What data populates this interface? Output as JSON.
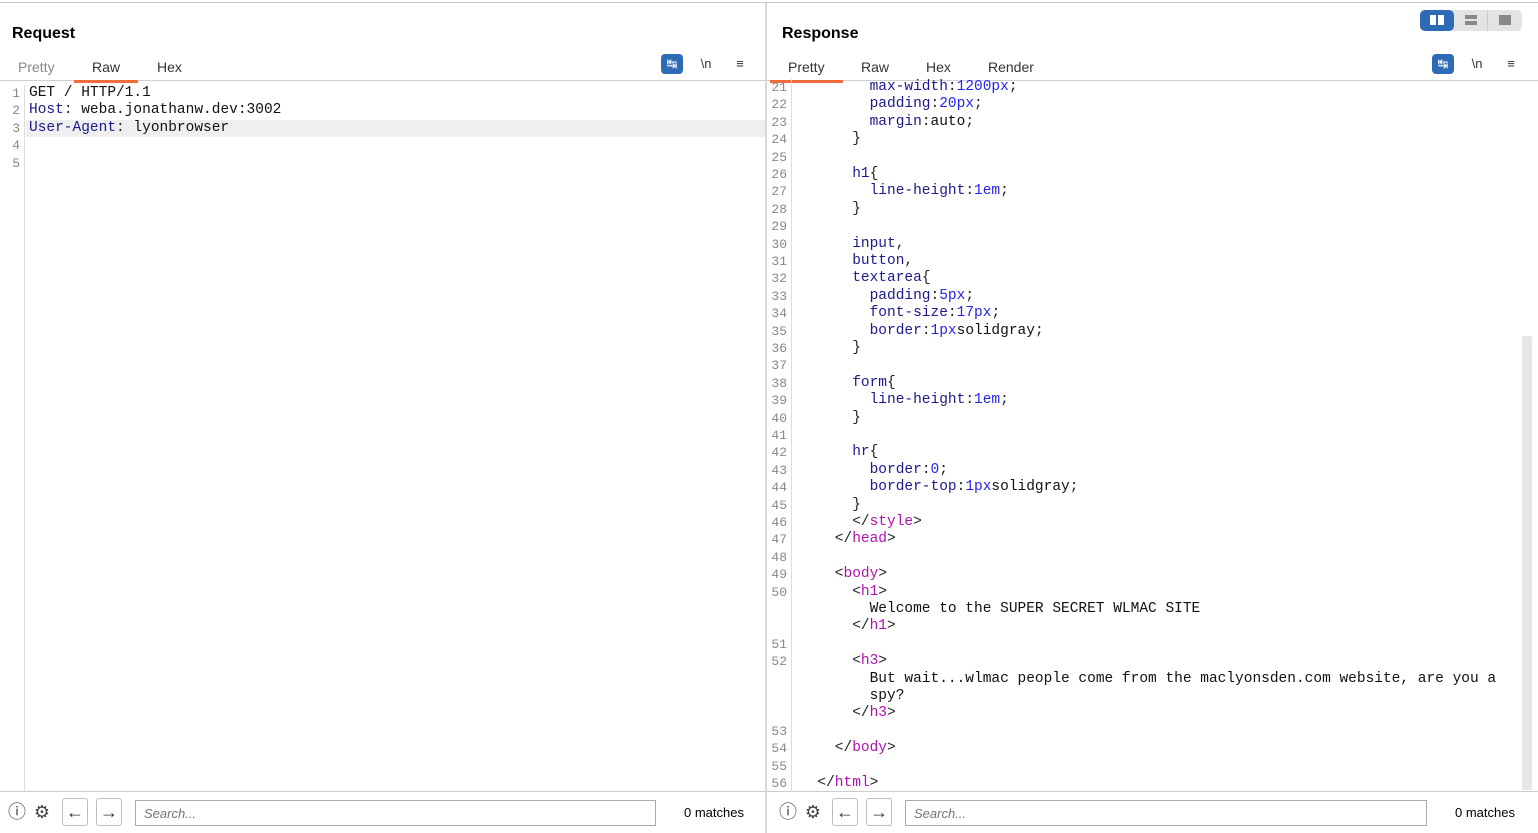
{
  "request": {
    "title": "Request",
    "tabs": [
      "Pretty",
      "Raw",
      "Hex"
    ],
    "active_tab": "Raw",
    "lines": [
      {
        "n": "1",
        "indent": 0,
        "tokens": [
          [
            "txt",
            "GET / HTTP/1.1"
          ]
        ]
      },
      {
        "n": "2",
        "indent": 0,
        "tokens": [
          [
            "prop",
            "Host"
          ],
          [
            "p",
            ": "
          ],
          [
            "txt",
            "weba.jonathanw.dev:3002"
          ]
        ]
      },
      {
        "n": "3",
        "indent": 0,
        "highlight": true,
        "tokens": [
          [
            "prop",
            "User-Agent"
          ],
          [
            "p",
            ": "
          ],
          [
            "txt",
            "lyonbrowser"
          ]
        ]
      },
      {
        "n": "4",
        "indent": 0,
        "tokens": []
      },
      {
        "n": "5",
        "indent": 0,
        "tokens": []
      }
    ],
    "search_placeholder": "Search...",
    "matches": "0 matches"
  },
  "response": {
    "title": "Response",
    "tabs": [
      "Pretty",
      "Raw",
      "Hex",
      "Render"
    ],
    "active_tab": "Pretty",
    "lines": [
      {
        "n": "21",
        "indent": 8,
        "tokens": [
          [
            "prop",
            "max-width"
          ],
          [
            "p",
            ":"
          ],
          [
            "val",
            "1200px"
          ],
          [
            "p",
            ";"
          ]
        ]
      },
      {
        "n": "22",
        "indent": 8,
        "tokens": [
          [
            "prop",
            "padding"
          ],
          [
            "p",
            ":"
          ],
          [
            "val",
            "20px"
          ],
          [
            "p",
            ";"
          ]
        ]
      },
      {
        "n": "23",
        "indent": 8,
        "tokens": [
          [
            "prop",
            "margin"
          ],
          [
            "p",
            ":"
          ],
          [
            "txt",
            "auto"
          ],
          [
            "p",
            ";"
          ]
        ]
      },
      {
        "n": "24",
        "indent": 6,
        "tokens": [
          [
            "p",
            "}"
          ]
        ]
      },
      {
        "n": "25",
        "indent": 0,
        "tokens": []
      },
      {
        "n": "26",
        "indent": 6,
        "tokens": [
          [
            "prop",
            "h1"
          ],
          [
            "p",
            "{"
          ]
        ]
      },
      {
        "n": "27",
        "indent": 8,
        "tokens": [
          [
            "prop",
            "line-height"
          ],
          [
            "p",
            ":"
          ],
          [
            "val",
            "1em"
          ],
          [
            "p",
            ";"
          ]
        ]
      },
      {
        "n": "28",
        "indent": 6,
        "tokens": [
          [
            "p",
            "}"
          ]
        ]
      },
      {
        "n": "29",
        "indent": 0,
        "tokens": []
      },
      {
        "n": "30",
        "indent": 6,
        "tokens": [
          [
            "prop",
            "input"
          ],
          [
            "p",
            ","
          ]
        ]
      },
      {
        "n": "31",
        "indent": 6,
        "tokens": [
          [
            "prop",
            "button"
          ],
          [
            "p",
            ","
          ]
        ]
      },
      {
        "n": "32",
        "indent": 6,
        "tokens": [
          [
            "prop",
            "textarea"
          ],
          [
            "p",
            "{"
          ]
        ]
      },
      {
        "n": "33",
        "indent": 8,
        "tokens": [
          [
            "prop",
            "padding"
          ],
          [
            "p",
            ":"
          ],
          [
            "val",
            "5px"
          ],
          [
            "p",
            ";"
          ]
        ]
      },
      {
        "n": "34",
        "indent": 8,
        "tokens": [
          [
            "prop",
            "font-size"
          ],
          [
            "p",
            ":"
          ],
          [
            "val",
            "17px"
          ],
          [
            "p",
            ";"
          ]
        ]
      },
      {
        "n": "35",
        "indent": 8,
        "tokens": [
          [
            "prop",
            "border"
          ],
          [
            "p",
            ":"
          ],
          [
            "val",
            "1px"
          ],
          [
            "txt",
            "solidgray"
          ],
          [
            "p",
            ";"
          ]
        ]
      },
      {
        "n": "36",
        "indent": 6,
        "tokens": [
          [
            "p",
            "}"
          ]
        ]
      },
      {
        "n": "37",
        "indent": 0,
        "tokens": []
      },
      {
        "n": "38",
        "indent": 6,
        "tokens": [
          [
            "prop",
            "form"
          ],
          [
            "p",
            "{"
          ]
        ]
      },
      {
        "n": "39",
        "indent": 8,
        "tokens": [
          [
            "prop",
            "line-height"
          ],
          [
            "p",
            ":"
          ],
          [
            "val",
            "1em"
          ],
          [
            "p",
            ";"
          ]
        ]
      },
      {
        "n": "40",
        "indent": 6,
        "tokens": [
          [
            "p",
            "}"
          ]
        ]
      },
      {
        "n": "41",
        "indent": 0,
        "tokens": []
      },
      {
        "n": "42",
        "indent": 6,
        "tokens": [
          [
            "prop",
            "hr"
          ],
          [
            "p",
            "{"
          ]
        ]
      },
      {
        "n": "43",
        "indent": 8,
        "tokens": [
          [
            "prop",
            "border"
          ],
          [
            "p",
            ":"
          ],
          [
            "val",
            "0"
          ],
          [
            "p",
            ";"
          ]
        ]
      },
      {
        "n": "44",
        "indent": 8,
        "tokens": [
          [
            "prop",
            "border-top"
          ],
          [
            "p",
            ":"
          ],
          [
            "val",
            "1px"
          ],
          [
            "txt",
            "solidgray"
          ],
          [
            "p",
            ";"
          ]
        ]
      },
      {
        "n": "45",
        "indent": 6,
        "tokens": [
          [
            "p",
            "}"
          ]
        ]
      },
      {
        "n": "46",
        "indent": 6,
        "tokens": [
          [
            "p",
            "</"
          ],
          [
            "tag",
            "style"
          ],
          [
            "p",
            ">"
          ]
        ]
      },
      {
        "n": "47",
        "indent": 4,
        "tokens": [
          [
            "p",
            "</"
          ],
          [
            "tag",
            "head"
          ],
          [
            "p",
            ">"
          ]
        ]
      },
      {
        "n": "48",
        "indent": 0,
        "tokens": []
      },
      {
        "n": "49",
        "indent": 4,
        "tokens": [
          [
            "p",
            "<"
          ],
          [
            "tag",
            "body"
          ],
          [
            "p",
            ">"
          ]
        ]
      },
      {
        "n": "50",
        "indent": 6,
        "tokens": [
          [
            "p",
            "<"
          ],
          [
            "tag",
            "h1"
          ],
          [
            "p",
            ">"
          ]
        ]
      },
      {
        "n": "",
        "indent": 8,
        "tokens": [
          [
            "txt",
            "Welcome to the SUPER SECRET WLMAC SITE"
          ]
        ]
      },
      {
        "n": "",
        "indent": 6,
        "tokens": [
          [
            "p",
            "</"
          ],
          [
            "tag",
            "h1"
          ],
          [
            "p",
            ">"
          ]
        ]
      },
      {
        "n": "51",
        "indent": 0,
        "tokens": []
      },
      {
        "n": "52",
        "indent": 6,
        "tokens": [
          [
            "p",
            "<"
          ],
          [
            "tag",
            "h3"
          ],
          [
            "p",
            ">"
          ]
        ]
      },
      {
        "n": "",
        "indent": 8,
        "tokens": [
          [
            "txt",
            "But wait...wlmac people come from the maclyonsden.com website, are you a"
          ]
        ]
      },
      {
        "n": "",
        "indent": 8,
        "tokens": [
          [
            "txt",
            "spy?"
          ]
        ]
      },
      {
        "n": "",
        "indent": 6,
        "tokens": [
          [
            "p",
            "</"
          ],
          [
            "tag",
            "h3"
          ],
          [
            "p",
            ">"
          ]
        ]
      },
      {
        "n": "53",
        "indent": 0,
        "tokens": []
      },
      {
        "n": "54",
        "indent": 4,
        "tokens": [
          [
            "p",
            "</"
          ],
          [
            "tag",
            "body"
          ],
          [
            "p",
            ">"
          ]
        ]
      },
      {
        "n": "55",
        "indent": 0,
        "tokens": []
      },
      {
        "n": "56",
        "indent": 2,
        "tokens": [
          [
            "p",
            "</"
          ],
          [
            "tag",
            "html"
          ],
          [
            "p",
            ">"
          ]
        ]
      }
    ],
    "search_placeholder": "Search...",
    "matches": "0 matches"
  },
  "toolbar": {
    "wrap_icon": "wrap-lines-icon",
    "newline_label": "\\n",
    "menu_icon": "hamburger-menu-icon"
  },
  "colors": {
    "accent_tab": "#f26b3a",
    "button_active": "#2d6bb5",
    "tag": "#b012b0",
    "property": "#1a1a8c",
    "value": "#2525f0"
  }
}
